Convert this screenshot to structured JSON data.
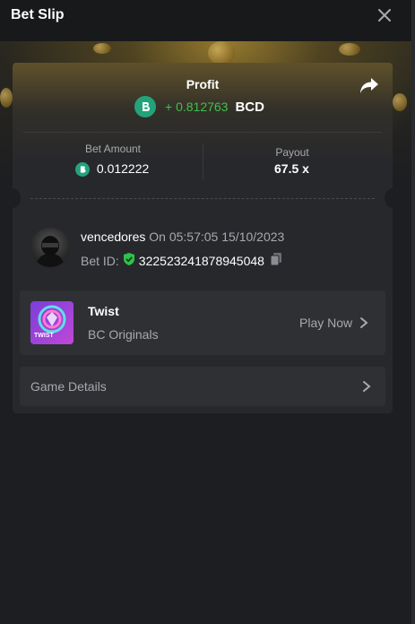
{
  "header": {
    "title": "Bet Slip",
    "close_icon": "close-icon"
  },
  "profit": {
    "label": "Profit",
    "value": "+ 0.812763",
    "currency": "BCD",
    "value_color": "#3fc14a",
    "currency_icon": "bcd-logo-icon",
    "share_icon": "share-icon"
  },
  "stats": {
    "bet_amount_label": "Bet Amount",
    "bet_amount_value": "0.012222",
    "payout_label": "Payout",
    "payout_value": "67.5 x"
  },
  "bet": {
    "username": "vencedores",
    "on_text": "On 05:57:05 15/10/2023",
    "bet_id_label": "Bet ID:",
    "bet_id": "322523241878945048"
  },
  "game": {
    "name": "Twist",
    "provider": "BC Originals",
    "thumb_label": "TWIST",
    "play_label": "Play Now"
  },
  "details": {
    "label": "Game Details"
  },
  "colors": {
    "background": "#1d1e21",
    "card": "#27282c",
    "panel": "#2f3034",
    "accent_green": "#23a37a",
    "muted_text": "#a7a9ae"
  }
}
